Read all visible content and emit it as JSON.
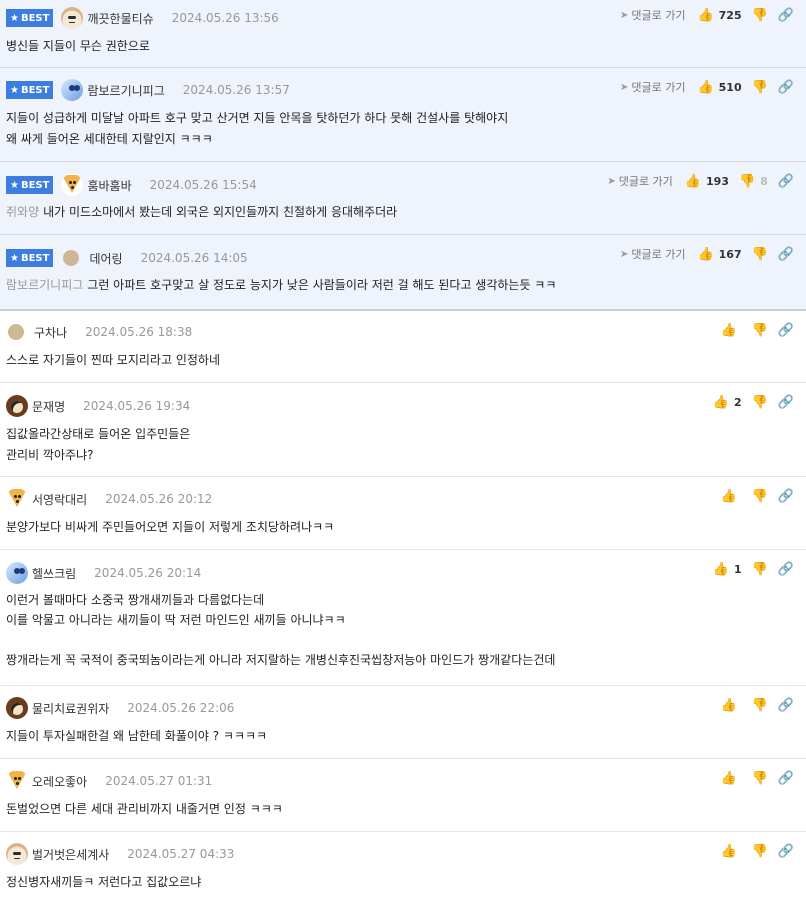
{
  "labels": {
    "best": "BEST",
    "goto": "댓글로 가기"
  },
  "comments": [
    {
      "best": true,
      "avatar": "dog-white-icon",
      "nick": "깨끗한물티슈",
      "date": "2024.05.26 13:56",
      "up": "725",
      "down": "",
      "mention": "",
      "lines": [
        "병신들 지들이 무슨 권한으로"
      ]
    },
    {
      "best": true,
      "avatar": "blue-dog-icon",
      "nick": "람보르기니피그",
      "date": "2024.05.26 13:57",
      "up": "510",
      "down": "",
      "mention": "",
      "lines": [
        "지들이 성급하게 미달날 아파트 호구 맞고 산거면 지들 안목을 탓하던가 하다 못해 건설사를 탓해야지",
        "왜 싸게 들어온 세대한테 지랄인지 ㅋㅋㅋ"
      ]
    },
    {
      "best": true,
      "avatar": "fox-icon",
      "nick": "훔바훔바",
      "date": "2024.05.26 15:54",
      "up": "193",
      "down": "8",
      "mention": "쥐와양",
      "lines": [
        "내가 미드소마에서 봤는데 외국은 외지인들까지 친절하게 응대해주더라"
      ]
    },
    {
      "best": true,
      "avatar": "plain-avatar-icon",
      "nick": "데어링",
      "date": "2024.05.26 14:05",
      "up": "167",
      "down": "",
      "mention": "람보르기니피그",
      "lines": [
        "그런 아파트 호구맞고 살 정도로 능지가 낮은 사람들이라 저런 걸 해도 된다고 생각하는듯 ㅋㅋ"
      ]
    },
    {
      "best": false,
      "avatar": "plain-avatar-icon",
      "nick": "구차나",
      "date": "2024.05.26 18:38",
      "up": "",
      "down": "",
      "mention": "",
      "lines": [
        "스스로 자기들이 찐따 모지리라고 인정하네"
      ]
    },
    {
      "best": false,
      "avatar": "bear-icon",
      "nick": "문재명",
      "date": "2024.05.26 19:34",
      "up": "2",
      "down": "",
      "mention": "",
      "lines": [
        "집값올라간상태로 들어온 입주민들은",
        "관리비 깍아주냐?"
      ]
    },
    {
      "best": false,
      "avatar": "fox-icon",
      "nick": "서영락대리",
      "date": "2024.05.26 20:12",
      "up": "",
      "down": "",
      "mention": "",
      "lines": [
        "분양가보다 비싸게 주민들어오면 지들이 저렇게 조치당하려나ㅋㅋ"
      ]
    },
    {
      "best": false,
      "avatar": "blue-dog-icon",
      "nick": "헬쓰크림",
      "date": "2024.05.26 20:14",
      "up": "1",
      "down": "",
      "mention": "",
      "lines": [
        "이런거 볼때마다 소중국 짱개새끼들과 다름없다는데",
        "이를 악물고 아니라는 새끼들이 딱 저런 마인드인 새끼들 아니냐ㅋㅋ",
        "",
        "짱개라는게 꼭 국적이 중국뙤놈이라는게 아니라 저지랄하는 개병신후진국씹창저능아 마인드가 짱개같다는건데"
      ]
    },
    {
      "best": false,
      "avatar": "bear-icon",
      "nick": "물리치료권위자",
      "date": "2024.05.26 22:06",
      "up": "",
      "down": "",
      "mention": "",
      "lines": [
        "지들이 투자실패한걸 왜 남한테 화풀이야 ? ㅋㅋㅋㅋ"
      ]
    },
    {
      "best": false,
      "avatar": "fox-icon",
      "nick": "오레오좋아",
      "date": "2024.05.27 01:31",
      "up": "",
      "down": "",
      "mention": "",
      "lines": [
        "돈벌었으면 다른 세대 관리비까지 내줄거면 인정 ㅋㅋㅋ"
      ]
    },
    {
      "best": false,
      "avatar": "dog-white-icon",
      "nick": "벌거벗은세계사",
      "date": "2024.05.27 04:33",
      "up": "",
      "down": "",
      "mention": "",
      "lines": [
        "정신병자새끼들ㅋ 저런다고 집값오르냐"
      ]
    }
  ]
}
